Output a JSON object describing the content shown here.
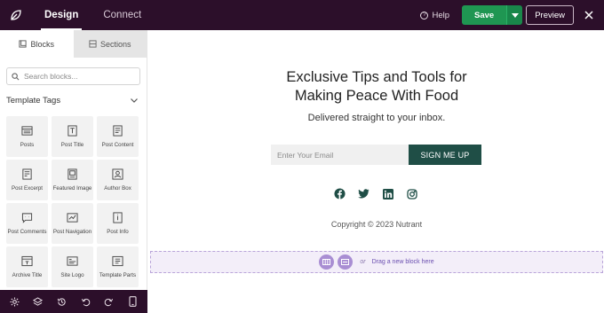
{
  "topbar": {
    "tabs": [
      {
        "label": "Design",
        "active": true
      },
      {
        "label": "Connect",
        "active": false
      }
    ],
    "help_label": "Help",
    "save_label": "Save",
    "preview_label": "Preview"
  },
  "sidebar": {
    "tabs": [
      {
        "label": "Blocks",
        "active": true
      },
      {
        "label": "Sections",
        "active": false
      }
    ],
    "search_placeholder": "Search blocks...",
    "section_title": "Template Tags",
    "blocks": [
      {
        "label": "Posts",
        "icon": "posts-icon"
      },
      {
        "label": "Post Title",
        "icon": "post-title-icon"
      },
      {
        "label": "Post Content",
        "icon": "post-content-icon"
      },
      {
        "label": "Post Excerpt",
        "icon": "post-excerpt-icon"
      },
      {
        "label": "Featured Image",
        "icon": "featured-image-icon"
      },
      {
        "label": "Author Box",
        "icon": "author-box-icon"
      },
      {
        "label": "Post Comments",
        "icon": "post-comments-icon"
      },
      {
        "label": "Post Navigation",
        "icon": "post-navigation-icon"
      },
      {
        "label": "Post Info",
        "icon": "post-info-icon"
      },
      {
        "label": "Archive Title",
        "icon": "archive-title-icon"
      },
      {
        "label": "Site Logo",
        "icon": "site-logo-icon"
      },
      {
        "label": "Template Parts",
        "icon": "template-parts-icon"
      }
    ]
  },
  "bottom_toolbar": {
    "icons": [
      "settings-icon",
      "layers-icon",
      "history-icon",
      "undo-icon",
      "redo-icon",
      "mobile-preview-icon"
    ]
  },
  "canvas": {
    "headline_line1": "Exclusive Tips and Tools for",
    "headline_line2": "Making Peace With Food",
    "subline": "Delivered straight to your inbox.",
    "email_placeholder": "Enter Your Email",
    "signup_label": "SIGN ME UP",
    "socials": [
      "facebook-icon",
      "twitter-icon",
      "linkedin-icon",
      "instagram-icon"
    ],
    "copyright": "Copyright © 2023 Nutrant",
    "dropzone_or": "or",
    "dropzone_text": "Drag a new block here"
  },
  "colors": {
    "topbar_bg": "#2c0f2a",
    "save_green": "#1f9652",
    "signup_teal": "#1f4e46",
    "dropzone_purple": "#a98ed3"
  }
}
